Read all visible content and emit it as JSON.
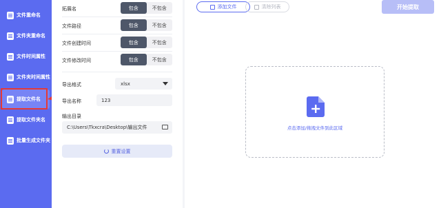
{
  "sidebar": {
    "items": [
      {
        "label": "文件重命名"
      },
      {
        "label": "文件夹重命名"
      },
      {
        "label": "文件时间属性"
      },
      {
        "label": "文件夹时间属性"
      },
      {
        "label": "提取文件名"
      },
      {
        "label": "提取文件夹名"
      },
      {
        "label": "批量生成文件夹"
      }
    ],
    "active_index": 4
  },
  "settings": {
    "rows": [
      {
        "label": "拓展名",
        "include": "包含",
        "exclude": "不包含"
      },
      {
        "label": "文件路径",
        "include": "包含",
        "exclude": "不包含"
      },
      {
        "label": "文件创建时间",
        "include": "包含",
        "exclude": "不包含"
      },
      {
        "label": "文件修改时间",
        "include": "包含",
        "exclude": "不包含"
      }
    ],
    "export_format_label": "导出格式",
    "export_format_value": "xlsx",
    "export_name_label": "导出名称",
    "export_name_value": "123",
    "output_dir_label": "输出目录",
    "output_dir_value": "C:\\Users\\Tkxcra\\Desktop\\输出文件",
    "reset_label": "重置设置"
  },
  "toolbar": {
    "add_label": "添加文件",
    "clear_label": "清除列表",
    "start_label": "开始提取"
  },
  "dropzone": {
    "hint": "点击添加/拖拽文件到此区域"
  },
  "colors": {
    "sidebar_bg": "#5b6bf0",
    "accent": "#5b6bf0",
    "toggle_on": "#4e5769",
    "annotation": "#e53935"
  }
}
